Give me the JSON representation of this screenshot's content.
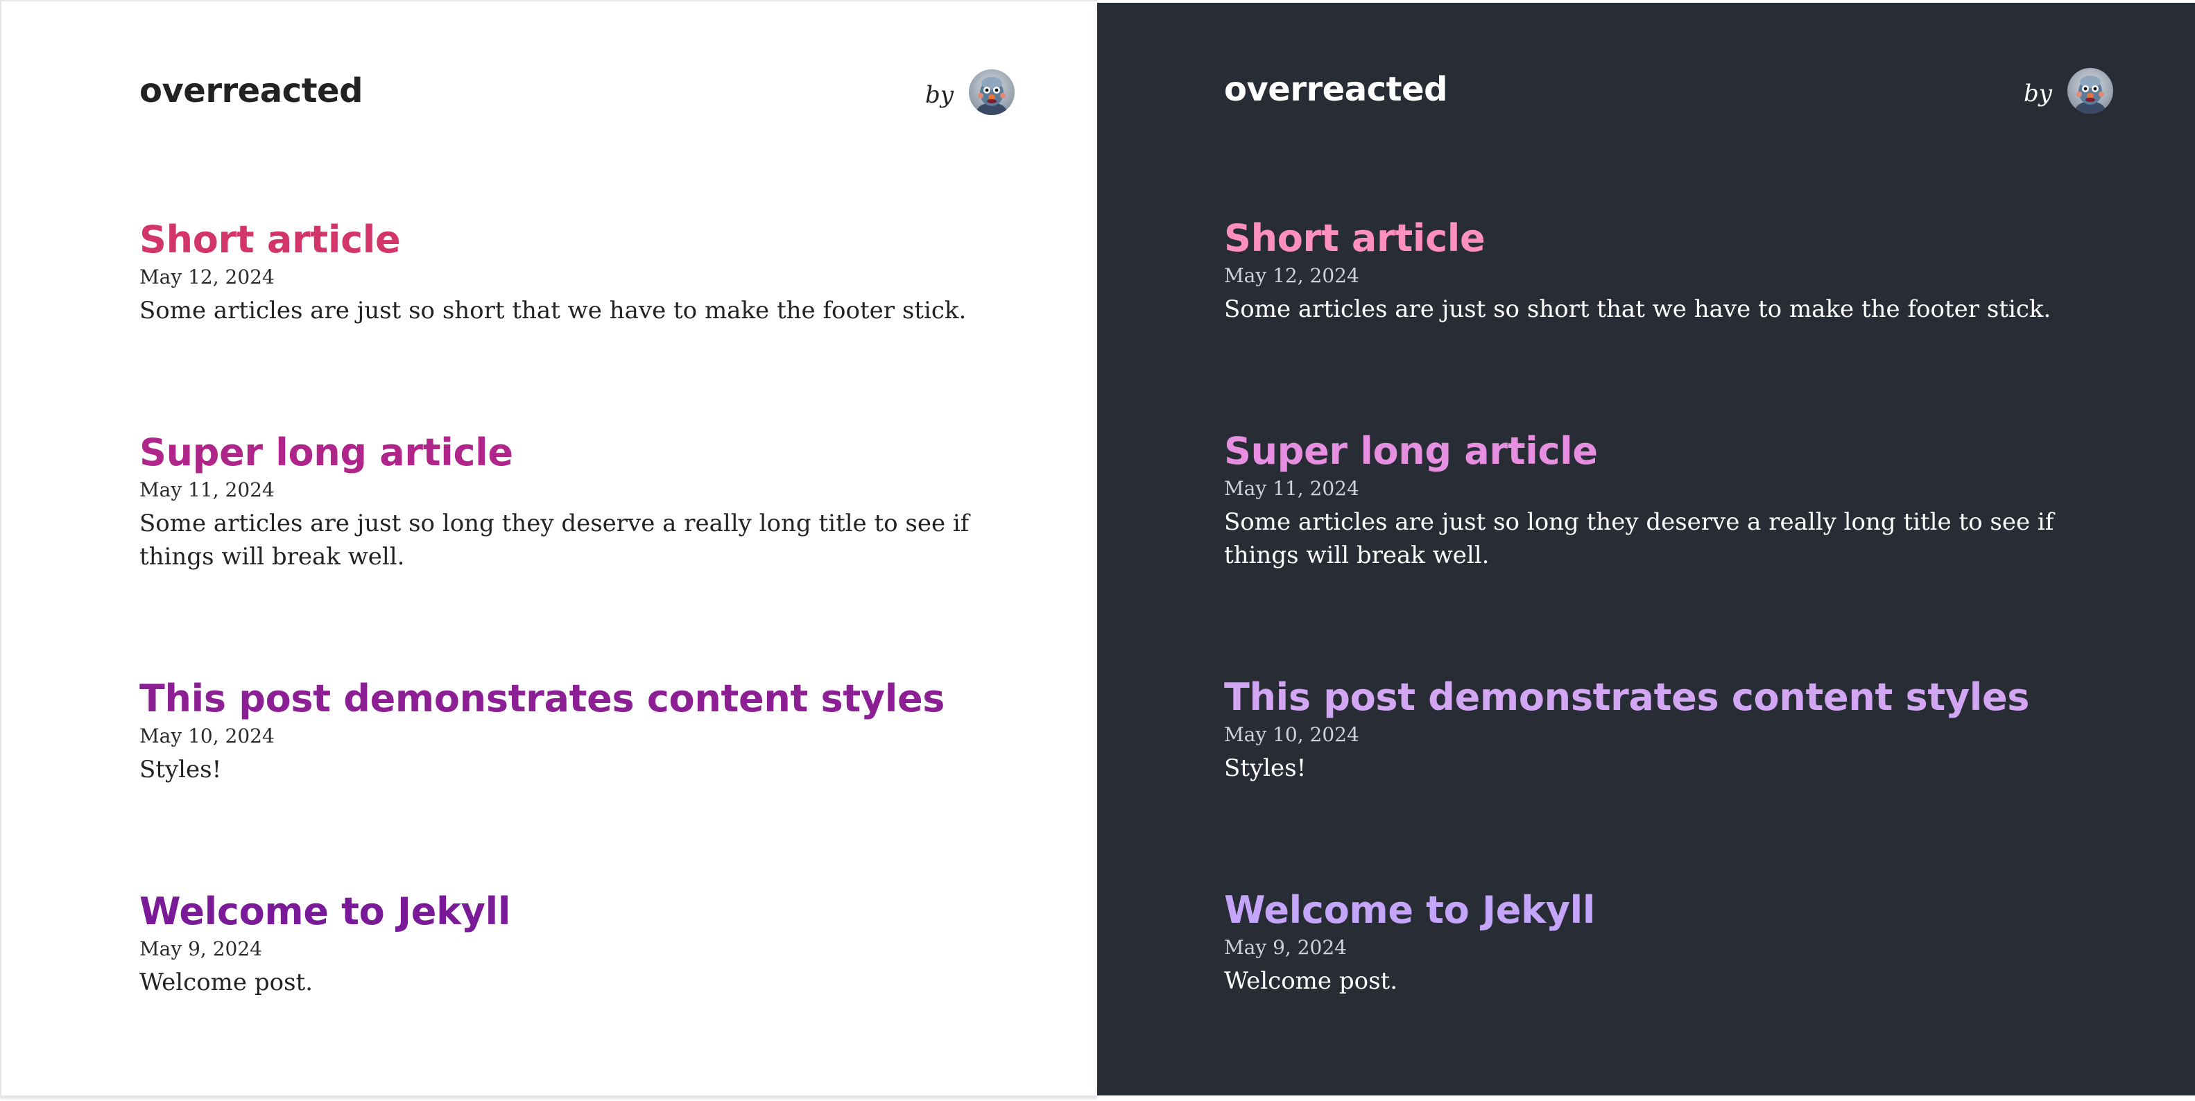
{
  "site": {
    "title": "overreacted",
    "byline": "by"
  },
  "themes": {
    "light": {
      "background": "#ffffff",
      "title_colors": [
        "#d23669",
        "#b0258a",
        "#8c1f93",
        "#7a1a98"
      ]
    },
    "dark": {
      "background": "#282c35",
      "title_colors": [
        "#ff8fc0",
        "#e68fe0",
        "#d2a6f2",
        "#c5a5fa"
      ]
    }
  },
  "posts": [
    {
      "title": "Short article",
      "date": "May 12, 2024",
      "excerpt": "Some articles are just so short that we have to make the footer stick."
    },
    {
      "title": "Super long article",
      "date": "May 11, 2024",
      "excerpt": "Some articles are just so long they deserve a really long title to see if things will break well."
    },
    {
      "title": "This post demonstrates content styles",
      "date": "May 10, 2024",
      "excerpt": "Styles!"
    },
    {
      "title": "Welcome to Jekyll",
      "date": "May 9, 2024",
      "excerpt": "Welcome post."
    }
  ]
}
